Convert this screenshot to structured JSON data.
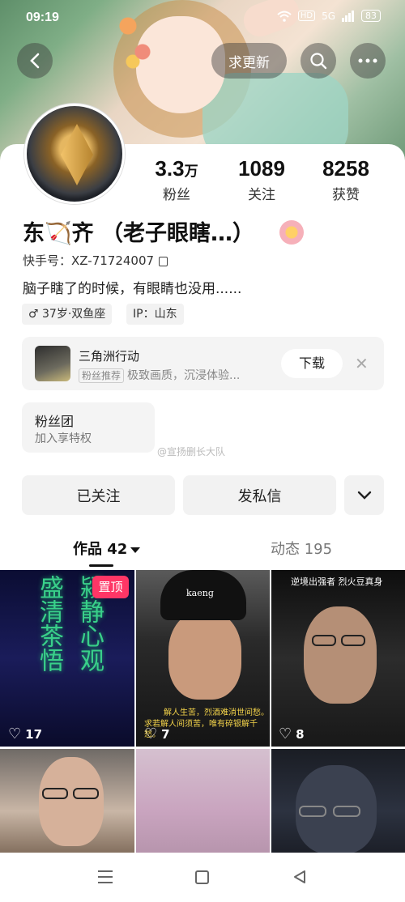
{
  "status_bar": {
    "time": "09:19",
    "hd": "HD",
    "network": "5G",
    "battery": "83"
  },
  "top_bar": {
    "update_label": "求更新"
  },
  "profile": {
    "stats": [
      {
        "value": "3.3",
        "unit": "万",
        "label": "粉丝"
      },
      {
        "value": "1089",
        "unit": "",
        "label": "关注"
      },
      {
        "value": "8258",
        "unit": "",
        "label": "获赞"
      }
    ],
    "name": "东🏹齐 （老子眼瞎…）",
    "kuaishou_id": "快手号：XZ-71724007",
    "bio": "脑子瞎了的时候，有眼睛也没用......",
    "tags": [
      "♂ 37岁·双鱼座",
      "IP：山东"
    ]
  },
  "ad": {
    "title": "三角洲行动",
    "pill": "粉丝推荐",
    "desc": "极致画质，沉浸体验...",
    "download_label": "下载",
    "close": "✕"
  },
  "fan_club": {
    "title": "粉丝团",
    "subtitle": "加入享特权"
  },
  "watermark": "@宣扬删长大队",
  "actions": {
    "followed": "已关注",
    "message": "发私信",
    "expand": "⌄"
  },
  "tabs": {
    "works": "作品 42",
    "dynamics": "动态 195"
  },
  "grid": {
    "pin_label": "置顶",
    "calligraphy": [
      "盛",
      "清",
      "茶",
      "悟",
      "颍",
      "静",
      "心",
      "观"
    ],
    "cap_text": "kaeng",
    "c2_caption_lines": [
      "解人生苦，烈酒难消世间愁。",
      "求若解人间须苦，唯有碎银解千愁。"
    ],
    "c3_caption": "逆境出强者 烈火豆真身",
    "likes": [
      "17",
      "7",
      "8"
    ]
  },
  "navbar": {
    "menu": "menu",
    "home": "home",
    "back": "back"
  }
}
